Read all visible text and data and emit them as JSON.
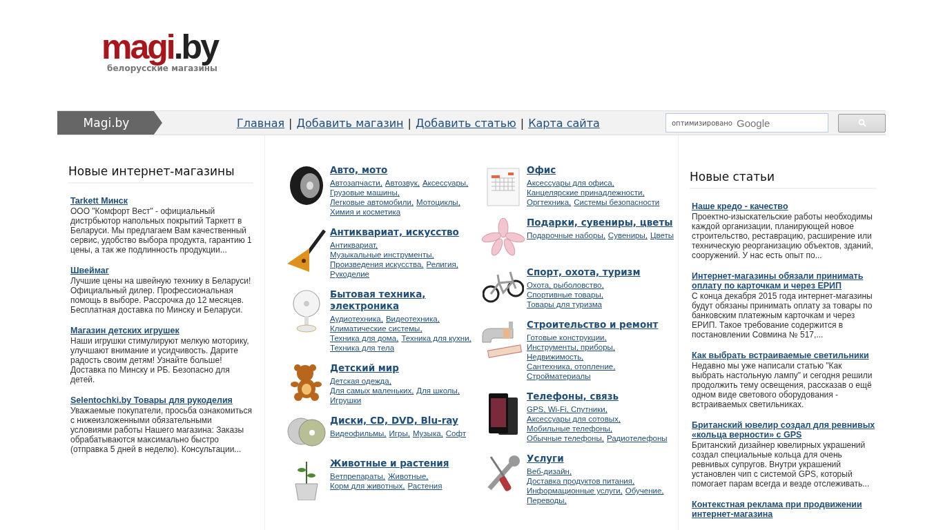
{
  "logo": {
    "brand_main": "magi",
    "brand_suffix": ".by",
    "tagline": "белорусские магазины"
  },
  "nav": {
    "home_tab": "Magi.by",
    "links": [
      {
        "label": "Главная"
      },
      {
        "separator": "|",
        "label": "Добавить магазин"
      },
      {
        "separator": "|",
        "label": "Добавить статью"
      },
      {
        "separator": "|",
        "label": "Карта сайта"
      }
    ]
  },
  "search": {
    "hint": "оптимизировано",
    "brand": "Google"
  },
  "new_shops": {
    "title": "Новые интернет-магазины",
    "items": [
      {
        "title": "Tarkett Минск",
        "text": "ООО \"Комфорт Вест\" - официальный дистрбьютор напольных покрытий Таркетт в Беларуси. Мы предлагаем Вам качественный сервис, удобство выбора продукта, гарантию 1 цены, а так же подлинность продукции..."
      },
      {
        "title": "Швеймаг",
        "text": "Лучшие цены на швейную технику в Беларуси! Официальный дилер. Профессиональная помощь в выборе. Рассрочка до 12 месяцев. Бесплатная доставка по Минску и Беларуси."
      },
      {
        "title": "Магазин детских игрушек",
        "text": "Наши игрушки стимулируют мелкую моторику, улучшают внимание и усидчивость. Дарите радость своим детям! Узнайте больше! Доставка по Минску и РБ. Безопасно для детей."
      },
      {
        "title": "Selentochki.by Товары для рукоделия",
        "text": "Уважаемые покупатели, просьба ознакомиться с нижеизложенными обязательными условиями работы Нашего магазина: Заказы обрабатываются максимально быстро (отправка 5 дней в неделю). Консультации..."
      }
    ]
  },
  "category_columns": [
    [
      {
        "title": "Авто, мото",
        "links": [
          "Автозапчасти,",
          "Автозвук,",
          "Аксессуары,",
          "Грузовые машины,",
          "Легковые автомобили,",
          "Мотоциклы,",
          "Химия и косметика"
        ]
      },
      {
        "title": "Антиквариат, искусство",
        "links": [
          "Антиквариат,",
          "Музыкальные инструменты,",
          "Произведения искусства,",
          "Религия,",
          "Рукоделие"
        ]
      },
      {
        "title": "Бытовая техника, электроника",
        "links": [
          "Аудиотехника,",
          "Видеотехника,",
          "Климатические системы,",
          "Техника для дома,",
          "Техника для кухни,",
          "Техника для тела"
        ]
      },
      {
        "title": "Детский мир",
        "links": [
          "Детская одежда,",
          "Для самых маленьких,",
          "Для школы,",
          "Игрушки"
        ]
      },
      {
        "title": "Диски, CD, DVD, Blu-ray",
        "links": [
          "Видеофильмы,",
          "Игры,",
          "Музыка,",
          "Софт"
        ]
      },
      {
        "title": "Животные и растения",
        "links": [
          "Ветпрепараты,",
          "Животные,",
          "Корм для животных,",
          "Растения"
        ]
      }
    ],
    [
      {
        "title": "Офис",
        "links": [
          "Аксессуары для офиса,",
          "Канцелярские принадлежности,",
          "Оргтехника,",
          "Системы безопасности"
        ]
      },
      {
        "title": "Подарки, сувениры, цветы",
        "links": [
          "Подарочные наборы,",
          "Сувениры,",
          "Цветы"
        ]
      },
      {
        "title": "Спорт, охота, туризм",
        "links": [
          "Охота, рыболовство,",
          "Спортивные товары,",
          "Товары для туризма"
        ]
      },
      {
        "title": "Строительство и ремонт",
        "links": [
          "Готовые конструкции,",
          "Инструменты, приборы,",
          "Недвижимость,",
          "Сантехника, отопление,",
          "Стройматериалы"
        ]
      },
      {
        "title": "Телефоны, связь",
        "links": [
          "GPS, Wi-Fi, Спутники,",
          "Аксессуары для сотовых,",
          "Мобильные телефоны,",
          "Обычные телефоны,",
          "Радиотелефоны"
        ]
      },
      {
        "title": "Услуги",
        "links": [
          "Веб-дизайн,",
          "Доставка продуктов питания,",
          "Информационные услуги,",
          "Обучение,",
          "Переводы,"
        ]
      }
    ]
  ],
  "new_articles": {
    "title": "Новые статьи",
    "items": [
      {
        "title": "Наше кредо - качество",
        "text": "Проектно-изыскательские работы необходимы каждой организации, планирующей новое строительство, реставрацию, расширение или техническую реорганизацию объектов, зданий, сооружений. У нас есть опыт по..."
      },
      {
        "title": "Интернет-магазины обязали принимать оплату по карточкам и через ЕРИП",
        "text": "С конца декабря 2015 года интернет-магазины будут обязаны принимать оплату за товары по банковским платежным карточкам и через ЕРИП. Такое требование содержится в постановлении Совмина № 517,..."
      },
      {
        "title": "Как выбрать встраиваемые светильники",
        "text": "Недавно мы уже написали статью \"Как выбрать настольную лампу\" и сегодня решили продолжить тему освещения, рассказав о ещё одном виде светового оборудования - встраиваемых светильниках."
      },
      {
        "title": "Британский ювелир создал для ревнивых «кольца верности» с GPS",
        "text": "Британский дизайнер ювелирных украшений создал специальные кольца для очень ревнивых супругов. Внутри украшений установлен чип с системой GPS, который помогает парам всегда и везде отслеживать..."
      },
      {
        "title": "Контекстная реклама при продвижении интернет-магазина"
      }
    ]
  }
}
